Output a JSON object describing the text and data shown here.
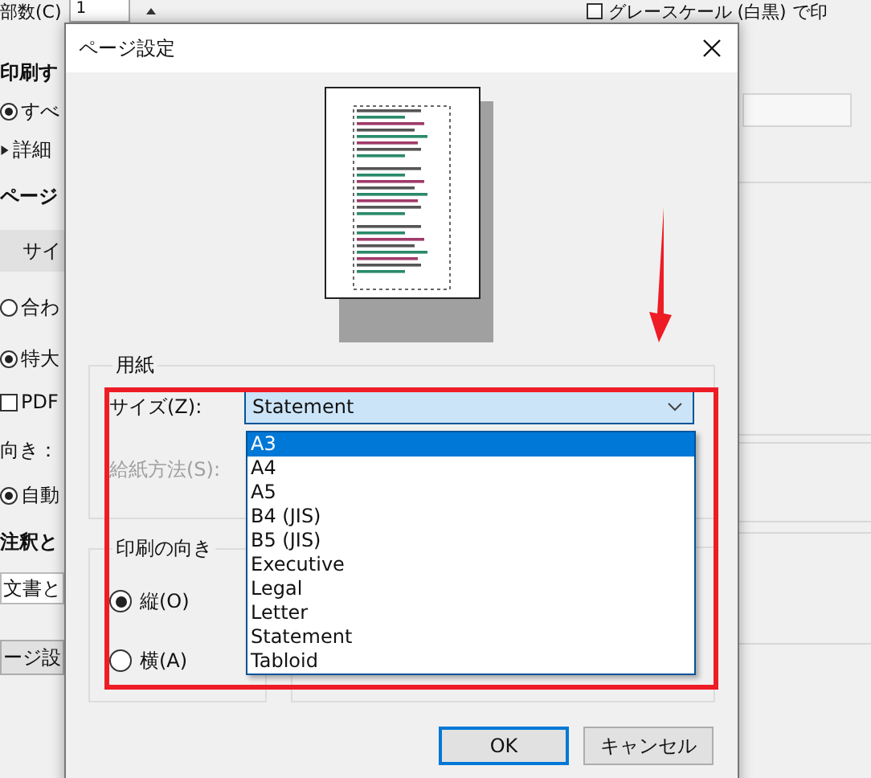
{
  "background_window": {
    "copies_label": "部数(C)",
    "copies_value": "1",
    "grayscale_checkbox": {
      "label": "グレースケール (白黒) で印",
      "checked": false
    },
    "left_items": [
      {
        "kind": "heading",
        "text": "印刷す"
      },
      {
        "kind": "radio",
        "text": "すべ",
        "checked": true
      },
      {
        "kind": "disclosure",
        "text": "詳細"
      },
      {
        "kind": "heading",
        "text": "ページ"
      },
      {
        "kind": "tab",
        "text": "サイ"
      },
      {
        "kind": "radio",
        "text": "合わ",
        "checked": false
      },
      {
        "kind": "radio",
        "text": "特大",
        "checked": true
      },
      {
        "kind": "checkbox",
        "text": "PDF",
        "checked": false
      },
      {
        "kind": "label",
        "text": "向き："
      },
      {
        "kind": "radio",
        "text": "自動",
        "checked": true
      },
      {
        "kind": "heading",
        "text": "注釈と"
      },
      {
        "kind": "dropdown",
        "text": "文書と"
      },
      {
        "kind": "button",
        "text": "ージ設"
      }
    ]
  },
  "dialog": {
    "title": "ページ設定",
    "paper": {
      "title": "用紙",
      "size": {
        "label": "サイズ(Z):",
        "value": "Statement",
        "expanded": true,
        "options": [
          {
            "label": "A3",
            "highlighted": true
          },
          {
            "label": "A4",
            "highlighted": false
          },
          {
            "label": "A5",
            "highlighted": false
          },
          {
            "label": "B4 (JIS)",
            "highlighted": false
          },
          {
            "label": "B5 (JIS)",
            "highlighted": false
          },
          {
            "label": "Executive",
            "highlighted": false
          },
          {
            "label": "Legal",
            "highlighted": false
          },
          {
            "label": "Letter",
            "highlighted": false
          },
          {
            "label": "Statement",
            "highlighted": false
          },
          {
            "label": "Tabloid",
            "highlighted": false
          }
        ]
      },
      "source": {
        "label": "給紙方法(S):",
        "disabled": true
      }
    },
    "orientation": {
      "title": "印刷の向き",
      "options": [
        {
          "label": "縦(O)",
          "selected": true
        },
        {
          "label": "横(A)",
          "selected": false
        }
      ]
    },
    "buttons": [
      {
        "label": "OK",
        "default": true
      },
      {
        "label": "キャンセル",
        "default": false
      }
    ]
  },
  "annotations": {
    "highlight_box": true,
    "arrow": true
  }
}
